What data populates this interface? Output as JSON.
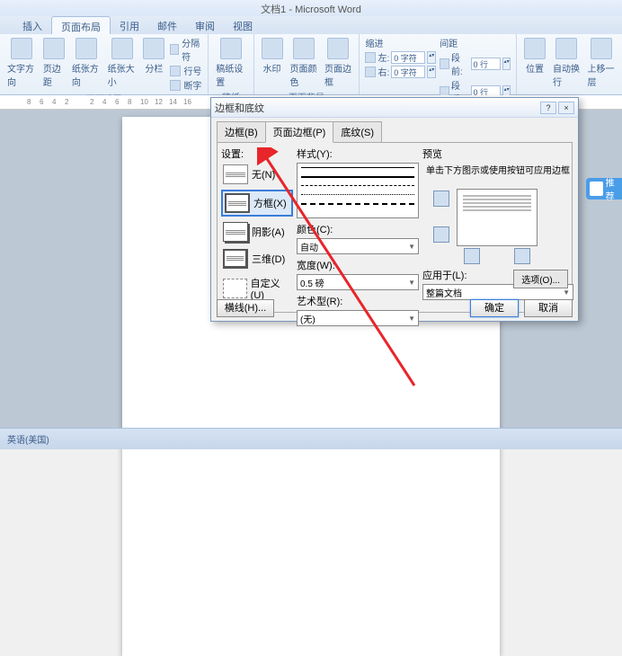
{
  "title": "文档1 - Microsoft Word",
  "tabs": [
    "插入",
    "页面布局",
    "引用",
    "邮件",
    "审阅",
    "视图"
  ],
  "active_tab": "页面布局",
  "groups": {
    "page_setup": {
      "label": "页面设置",
      "items": [
        "文字方向",
        "页边距",
        "纸张方向",
        "纸张大小",
        "分栏"
      ],
      "small": [
        "分隔符",
        "行号",
        "断字"
      ]
    },
    "watermark": {
      "label": "稿纸",
      "item": "稿纸设置"
    },
    "bg": {
      "label": "页面背景",
      "items": [
        "水印",
        "页面颜色",
        "页面边框"
      ]
    },
    "para": {
      "label": "段落",
      "indent_l": "缩进",
      "indent_left_lbl": "左:",
      "indent_left": "0 字符",
      "indent_right_lbl": "右:",
      "indent_right": "0 字符",
      "spacing_l": "间距",
      "before_lbl": "段前:",
      "before": "0 行",
      "after_lbl": "段后:",
      "after": "0 行"
    },
    "arrange": {
      "items": [
        "位置",
        "自动换行",
        "上移一层"
      ]
    }
  },
  "dialog": {
    "title": "边框和底纹",
    "tabs": [
      "边框(B)",
      "页面边框(P)",
      "底纹(S)"
    ],
    "active_tab": 1,
    "settings": {
      "label": "设置:",
      "opts": [
        "无(N)",
        "方框(X)",
        "阴影(A)",
        "三维(D)",
        "自定义(U)"
      ]
    },
    "style": {
      "label": "样式(Y):",
      "color_lbl": "颜色(C):",
      "color": "自动",
      "width_lbl": "宽度(W):",
      "width": "0.5 磅",
      "art_lbl": "艺术型(R):",
      "art": "(无)"
    },
    "preview": {
      "label": "预览",
      "hint": "单击下方图示或使用按钮可应用边框"
    },
    "apply": {
      "label": "应用于(L):",
      "value": "整篇文档"
    },
    "options": "选项(O)...",
    "hline": "横线(H)...",
    "ok": "确定",
    "cancel": "取消"
  },
  "status": {
    "lang": "英语(美国)"
  },
  "side": "推荐"
}
